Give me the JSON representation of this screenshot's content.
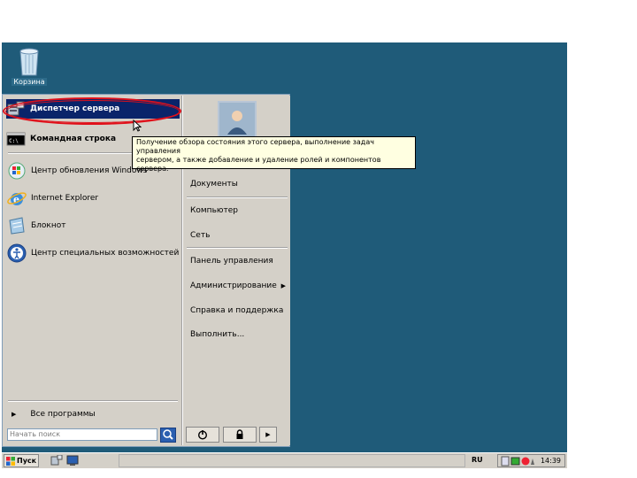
{
  "desktop": {
    "recycle_bin_label": "Корзина"
  },
  "start_menu": {
    "pinned": [
      {
        "label": "Диспетчер сервера",
        "icon": "server-manager-icon"
      },
      {
        "label": "Командная строка",
        "icon": "cmd-icon"
      }
    ],
    "recent": [
      {
        "label": "Центр обновления Windows",
        "icon": "windows-update-icon"
      },
      {
        "label": "Internet Explorer",
        "icon": "internet-explorer-icon"
      },
      {
        "label": "Блокнот",
        "icon": "notepad-icon"
      },
      {
        "label": "Центр специальных возможностей",
        "icon": "accessibility-icon"
      }
    ],
    "all_programs": "Все программы",
    "search_placeholder": "Начать поиск",
    "right_items": [
      "Документы",
      "Компьютер",
      "Сеть",
      "Панель управления",
      "Администрирование",
      "Справка и поддержка",
      "Выполнить..."
    ]
  },
  "tooltip": {
    "line1": "Получение обзора состояния этого сервера, выполнение задач управления",
    "line2": "сервером, а также добавление и удаление ролей и компонентов",
    "line3": "сервера."
  },
  "taskbar": {
    "start_label": "Пуск",
    "language": "RU",
    "clock": "14:39"
  },
  "colors": {
    "desktop": "#1f5b79",
    "selection": "#0a246a",
    "highlight": "#e0101a",
    "tooltip_bg": "#ffffe1"
  }
}
